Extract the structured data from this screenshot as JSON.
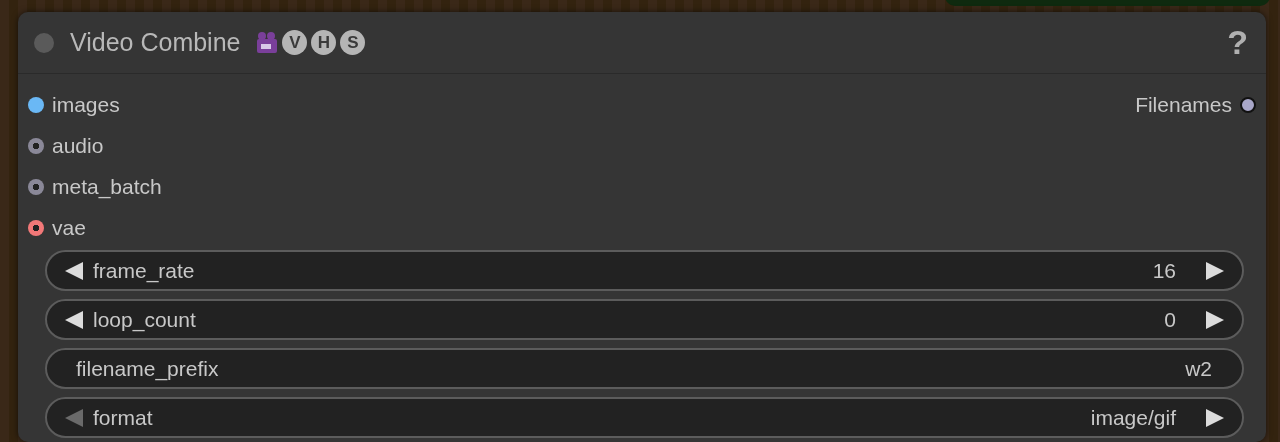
{
  "node": {
    "title": "Video Combine",
    "badges": [
      "V",
      "H",
      "S"
    ],
    "help": "?",
    "inputs": [
      {
        "name": "images",
        "color": "#6ab8f5",
        "connected": true
      },
      {
        "name": "audio",
        "color": "#8a8898",
        "connected": false
      },
      {
        "name": "meta_batch",
        "color": "#8a8898",
        "connected": false
      },
      {
        "name": "vae",
        "color": "#f27878",
        "connected": false
      }
    ],
    "outputs": [
      {
        "name": "Filenames",
        "color": "#a8a6c8",
        "connected": false
      }
    ],
    "widgets": [
      {
        "kind": "number",
        "label": "frame_rate",
        "value": "16",
        "left_disabled": false
      },
      {
        "kind": "number",
        "label": "loop_count",
        "value": "0",
        "left_disabled": false
      },
      {
        "kind": "text",
        "label": "filename_prefix",
        "value": "w2"
      },
      {
        "kind": "combo",
        "label": "format",
        "value": "image/gif",
        "left_disabled": true
      }
    ]
  }
}
